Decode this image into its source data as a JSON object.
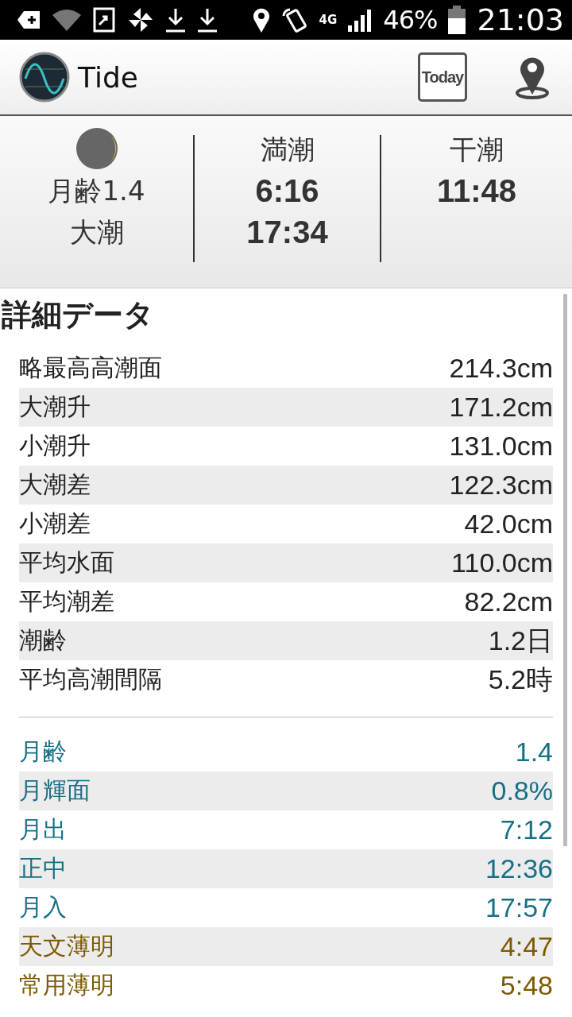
{
  "status_bar": {
    "network": "4G",
    "battery": "46%",
    "time": "21:03"
  },
  "toolbar": {
    "title": "Tide",
    "today_button": "Today"
  },
  "summary": {
    "moon_age": "月齢1.4",
    "tide_type": "大潮",
    "high_tide": {
      "label": "満潮",
      "times": [
        "6:16",
        "17:34"
      ]
    },
    "low_tide": {
      "label": "干潮",
      "times": [
        "11:48"
      ]
    }
  },
  "details": {
    "title": "詳細データ",
    "rows": [
      {
        "kind": "tide",
        "label": "略最高高潮面",
        "value": "214.3cm"
      },
      {
        "kind": "tide",
        "label": "大潮升",
        "value": "171.2cm"
      },
      {
        "kind": "tide",
        "label": "小潮升",
        "value": "131.0cm"
      },
      {
        "kind": "tide",
        "label": "大潮差",
        "value": "122.3cm"
      },
      {
        "kind": "tide",
        "label": "小潮差",
        "value": "42.0cm"
      },
      {
        "kind": "tide",
        "label": "平均水面",
        "value": "110.0cm"
      },
      {
        "kind": "tide",
        "label": "平均潮差",
        "value": "82.2cm"
      },
      {
        "kind": "tide",
        "label": "潮齢",
        "value": "1.2日"
      },
      {
        "kind": "tide",
        "label": "平均高潮間隔",
        "value": "5.2時"
      },
      {
        "kind": "divider"
      },
      {
        "kind": "moon",
        "label": "月齢",
        "value": "1.4"
      },
      {
        "kind": "moon",
        "label": "月輝面",
        "value": "0.8%"
      },
      {
        "kind": "moon",
        "label": "月出",
        "value": "7:12"
      },
      {
        "kind": "moon",
        "label": "正中",
        "value": "12:36"
      },
      {
        "kind": "moon",
        "label": "月入",
        "value": "17:57"
      },
      {
        "kind": "sun",
        "label": "天文薄明",
        "value": "4:47"
      },
      {
        "kind": "sun",
        "label": "常用薄明",
        "value": "5:48"
      }
    ]
  }
}
